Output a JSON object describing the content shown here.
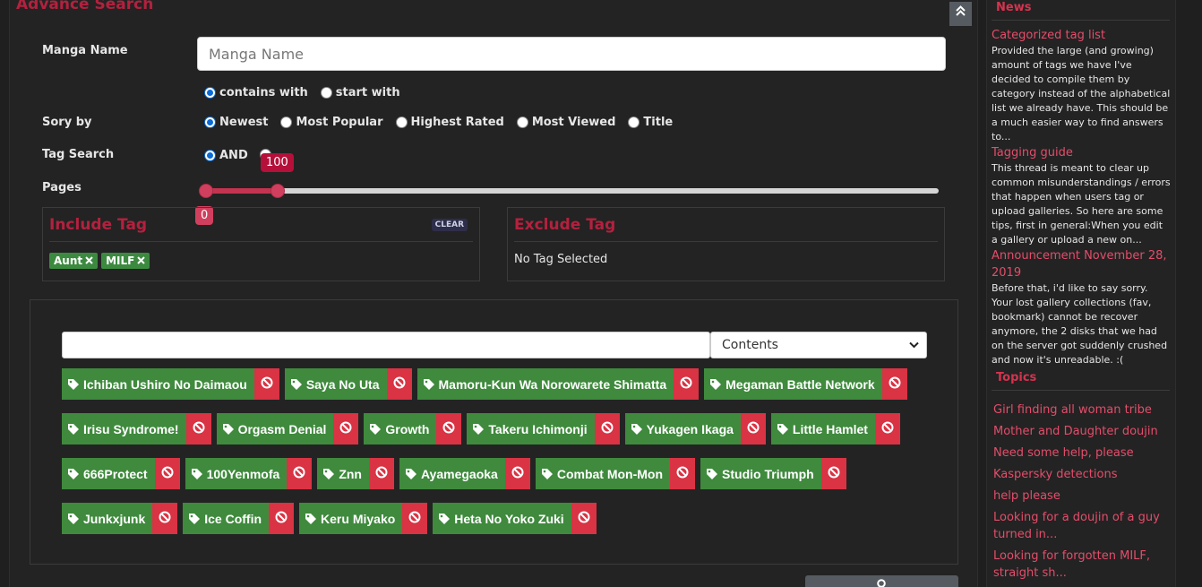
{
  "advanced": {
    "title": "Advance Search",
    "collapse_icon": "double-chevron-up-icon",
    "manga_name_label": "Manga Name",
    "manga_name_placeholder": "Manga Name",
    "match_options": [
      {
        "label": "contains with",
        "checked": true
      },
      {
        "label": "start with",
        "checked": false
      }
    ],
    "sort_label": "Sory by",
    "sort_options": [
      {
        "label": "Newest",
        "checked": true
      },
      {
        "label": "Most Popular",
        "checked": false
      },
      {
        "label": "Highest Rated",
        "checked": false
      },
      {
        "label": "Most Viewed",
        "checked": false
      },
      {
        "label": "Title",
        "checked": false
      }
    ],
    "tag_search_label": "Tag Search",
    "tag_search_options": [
      {
        "label": "AND",
        "checked": true
      }
    ],
    "pages_label": "Pages",
    "pages_slider": {
      "min_value": "0",
      "max_value": "100",
      "min_fraction": 0.0,
      "max_fraction": 0.1
    }
  },
  "include": {
    "title": "Include Tag",
    "clear_label": "CLEAR",
    "chips": [
      "Aunt",
      "MILF"
    ]
  },
  "exclude": {
    "title": "Exclude Tag",
    "empty_text": "No Tag Selected"
  },
  "tag_panel": {
    "search_value": "",
    "select_value": "Contents",
    "rows": [
      [
        "Ichiban Ushiro No Daimaou",
        "Saya No Uta",
        "Mamoru-Kun Wa Norowarete Shimatta",
        "Megaman Battle Network"
      ],
      [
        "Irisu Syndrome!",
        "Orgasm Denial",
        "Growth",
        "Takeru Ichimonji",
        "Yukagen Ikaga",
        "Little Hamlet"
      ],
      [
        "666Protect",
        "100Yenmofa",
        "Znn",
        "Ayamegaoka",
        "Combat Mon-Mon",
        "Studio Triumph"
      ],
      [
        "Junkxjunk",
        "Ice Coffin",
        "Keru Miyako",
        "Heta No Yoko Zuki"
      ]
    ]
  },
  "sidebar": {
    "news_heading": "News",
    "news": [
      {
        "title": "Categorized tag list",
        "body": "Provided the large (and growing) amount of tags we have I've decided to compile them by category instead of the alphabetical list we already have. This should be a much easier way to find answers to..."
      },
      {
        "title": "Tagging guide",
        "body": "This thread is meant to clear up common misunderstandings / errors that happen when users tag or upload galleries. So here are some tips, first in general:When you edit a gallery or upload a new on..."
      },
      {
        "title": "Announcement November 28, 2019",
        "body": "Before that, i'd like to say sorry. Your lost gallery collections (fav, bookmark) cannot be recover anymore, the 2 disks that we had on the server got suddenly crushed and now it's unreadable. :("
      }
    ],
    "topics_heading": "Topics",
    "topics": [
      "Girl finding all woman tribe",
      "Mother and Daughter doujin",
      "Need some help, please",
      "Kaspersky detections",
      "help please",
      "Looking for a doujin of a guy turned in...",
      "Looking for forgotten MILF, straight sh..."
    ]
  },
  "colors": {
    "accent": "#b3213e",
    "tag_green": "#3f8a3d",
    "ban_red": "#d93344",
    "link_pink": "#e44d6a"
  }
}
